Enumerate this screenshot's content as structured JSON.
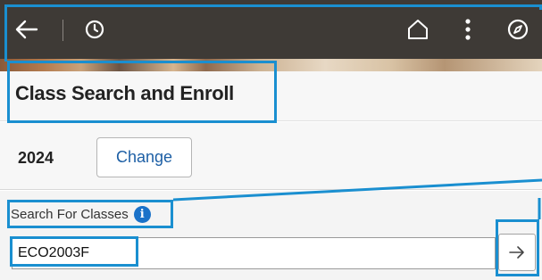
{
  "header": {
    "back_icon": "back-arrow-icon",
    "history_icon": "clock-icon",
    "home_icon": "home-icon",
    "menu_icon": "kebab-menu-icon",
    "navigator_icon": "compass-icon",
    "bar_color": "#3e3a36"
  },
  "page": {
    "title": "Class Search and Enroll"
  },
  "term": {
    "label": "2024",
    "change_button": "Change"
  },
  "search": {
    "label": "Search For Classes",
    "info_icon": "info-icon",
    "value": "ECO2003F",
    "submit_icon": "arrow-right-icon"
  },
  "colors": {
    "highlight": "#1a8fd0",
    "link": "#1d5fa5",
    "info": "#1a72c9"
  }
}
